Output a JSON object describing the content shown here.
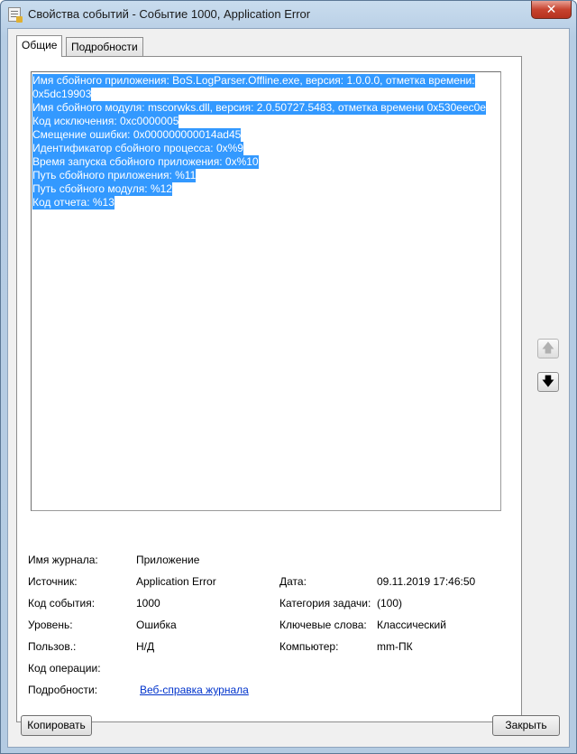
{
  "window": {
    "title": "Свойства событий - Событие 1000, Application Error",
    "close_glyph": "✕"
  },
  "tabs": [
    {
      "label": "Общие",
      "active": true
    },
    {
      "label": "Подробности",
      "active": false
    }
  ],
  "description": {
    "lines": [
      "Имя сбойного приложения: BoS.LogParser.Offline.exe, версия: 1.0.0.0, отметка времени:",
      "0x5dc19903",
      "Имя сбойного модуля: mscorwks.dll, версия: 2.0.50727.5483, отметка времени 0x530eec0e",
      "Код исключения: 0xc0000005",
      "Смещение ошибки: 0x000000000014ad45",
      "Идентификатор сбойного процесса: 0x%9",
      "Время запуска сбойного приложения: 0x%10",
      "Путь сбойного приложения: %11",
      "Путь сбойного модуля: %12",
      "Код отчета: %13"
    ],
    "selection_color": "#3399ff"
  },
  "fields": {
    "log_name": {
      "label": "Имя журнала:",
      "value": "Приложение"
    },
    "source": {
      "label": "Источник:",
      "value": "Application Error"
    },
    "date": {
      "label": "Дата:",
      "value": "09.11.2019 17:46:50"
    },
    "event_id": {
      "label": "Код события:",
      "value": "1000"
    },
    "task_category": {
      "label": "Категория задачи:",
      "value": "(100)"
    },
    "level": {
      "label": "Уровень:",
      "value": "Ошибка"
    },
    "keywords": {
      "label": "Ключевые слова:",
      "value": "Классический"
    },
    "user": {
      "label": "Пользов.:",
      "value": "Н/Д"
    },
    "computer": {
      "label": "Компьютер:",
      "value": "mm-ПК"
    },
    "opcode": {
      "label": "Код операции:",
      "value": ""
    },
    "more_info": {
      "label": "Подробности:",
      "link": "Веб-справка журнала"
    }
  },
  "nav": {
    "up_glyph": "🡅",
    "down_glyph": "🡇"
  },
  "buttons": {
    "copy": "Копировать",
    "close": "Закрыть"
  }
}
